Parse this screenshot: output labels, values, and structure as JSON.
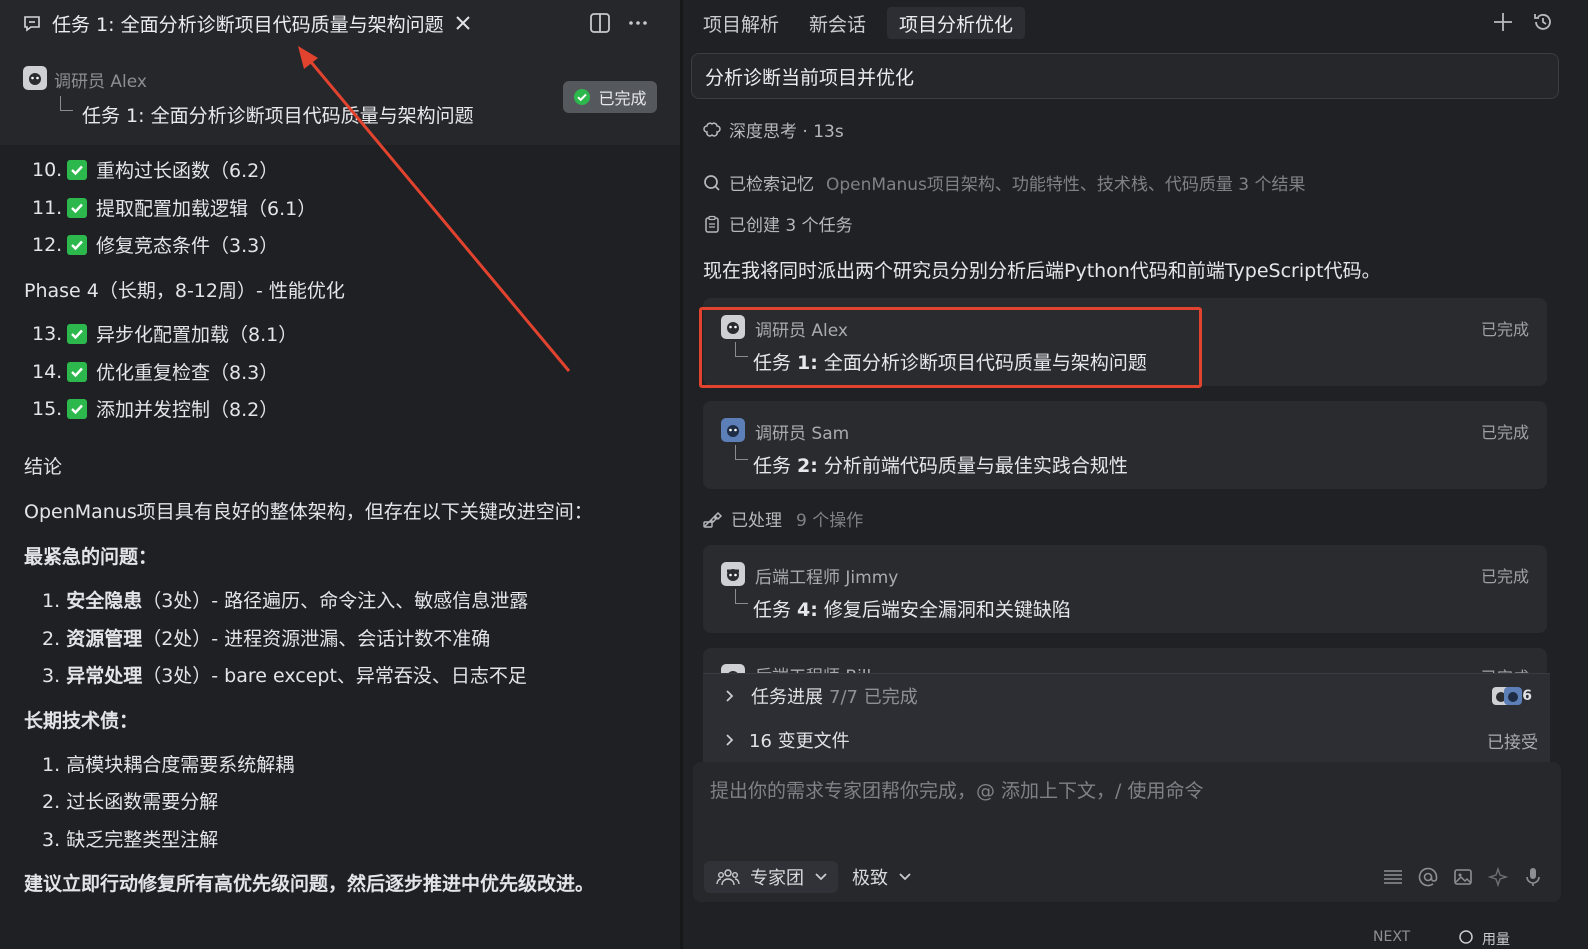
{
  "left": {
    "tab_title": "任务 1: 全面分析诊断项目代码质量与架构问题",
    "agent_name": "调研员 Alex",
    "task_line": "任务 1: 全面分析诊断项目代码质量与架构问题",
    "status_badge": "已完成",
    "items": [
      {
        "num": "10.",
        "text": "重构过长函数（6.2）"
      },
      {
        "num": "11.",
        "text": "提取配置加载逻辑（6.1）"
      },
      {
        "num": "12.",
        "text": "修复竞态条件（3.3）"
      }
    ],
    "phase4_title": "Phase 4（长期，8-12周）- 性能优化",
    "phase4_items": [
      {
        "num": "13.",
        "text": "异步化配置加载（8.1）"
      },
      {
        "num": "14.",
        "text": "优化重复检查（8.3）"
      },
      {
        "num": "15.",
        "text": "添加并发控制（8.2）"
      }
    ],
    "conclusion_title": "结论",
    "conclusion_text": "OpenManus项目具有良好的整体架构，但存在以下关键改进空间：",
    "urgent_title": "最紧急的问题：",
    "urgent_items": [
      {
        "num": "1.",
        "bold": "安全隐患",
        "rest": "（3处）- 路径遍历、命令注入、敏感信息泄露"
      },
      {
        "num": "2.",
        "bold": "资源管理",
        "rest": "（2处）- 进程资源泄漏、会话计数不准确"
      },
      {
        "num": "3.",
        "bold": "异常处理",
        "rest": "（3处）- bare except、异常吞没、日志不足"
      }
    ],
    "debt_title": "长期技术债：",
    "debt_items": [
      {
        "num": "1.",
        "text": "高模块耦合度需要系统解耦"
      },
      {
        "num": "2.",
        "text": "过长函数需要分解"
      },
      {
        "num": "3.",
        "text": "缺乏完整类型注解"
      }
    ],
    "final_text": "建议立即行动修复所有高优先级问题，然后逐步推进中优先级改进。"
  },
  "right": {
    "tabs": [
      "项目解析",
      "新会话",
      "项目分析优化"
    ],
    "prompt": "分析诊断当前项目并优化",
    "thinking": "深度思考 · 13s",
    "memory_label": "已检索记忆",
    "memory_detail": "OpenManus项目架构、功能特性、技术栈、代码质量 3 个结果",
    "tasks_created": "已创建 3 个任务",
    "dispatch_text": "现在我将同时派出两个研究员分别分析后端Python代码和前端TypeScript代码。",
    "cards": [
      {
        "name": "调研员 Alex",
        "task_prefix": "任务 ",
        "task_num": "1:",
        "task_rest": " 全面分析诊断项目代码质量与架构问题",
        "status": "已完成"
      },
      {
        "name": "调研员 Sam",
        "task_prefix": "任务 ",
        "task_num": "2:",
        "task_rest": " 分析前端代码质量与最佳实践合规性",
        "status": "已完成"
      }
    ],
    "processed_label": "已处理",
    "processed_detail": "9 个操作",
    "card3": {
      "name": "后端工程师 Jimmy",
      "task_prefix": "任务 ",
      "task_num": "4:",
      "task_rest": " 修复后端安全漏洞和关键缺陷",
      "status": "已完成"
    },
    "card4_partial_name": "后端工程师 Bill",
    "card4_partial_status": "已完成",
    "progress_label": "任务进展",
    "progress_detail": "7/7 已完成",
    "progress_count": "6",
    "files_label": "16 变更文件",
    "files_status": "已接受",
    "input_placeholder": "提出你的需求专家团帮你完成，@ 添加上下文，/ 使用命令",
    "mode_label": "专家团",
    "speed_label": "极致",
    "footer_partial": "NEXT",
    "footer_partial2": "用量"
  },
  "colors": {
    "accent_red": "#e2432f",
    "green": "#2db84d"
  }
}
